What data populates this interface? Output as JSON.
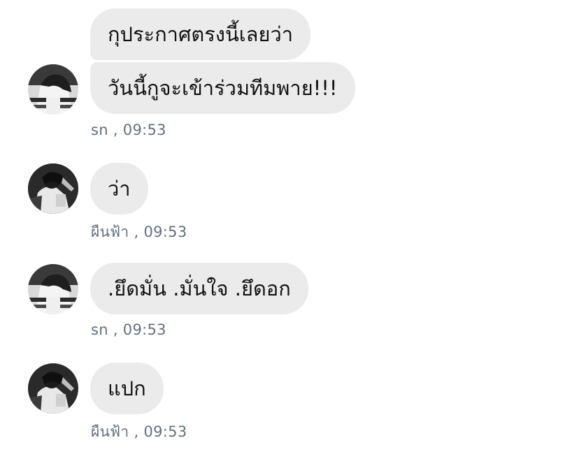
{
  "messages": [
    {
      "sender": "sn",
      "lines": [
        "กุประกาศตรงนี้เลยว่า",
        "วันนี้กูจะเข้าร่วมทีมพาย!!!"
      ],
      "time": "09:53",
      "avatar": "avatar-sn"
    },
    {
      "sender": "ผืนฟ้า",
      "lines": [
        "ว่า"
      ],
      "time": "09:53",
      "avatar": "avatar-phuenfa"
    },
    {
      "sender": "sn",
      "lines": [
        ".ยึดมั่น .มั่นใจ .ยึดอก"
      ],
      "time": "09:53",
      "avatar": "avatar-sn"
    },
    {
      "sender": "ผืนฟ้า",
      "lines": [
        "แปก"
      ],
      "time": "09:53",
      "avatar": "avatar-phuenfa"
    }
  ],
  "meta_separator": " , ",
  "colors": {
    "bubble": "#ebebeb",
    "meta_text": "#667080",
    "message_text": "#111111"
  }
}
